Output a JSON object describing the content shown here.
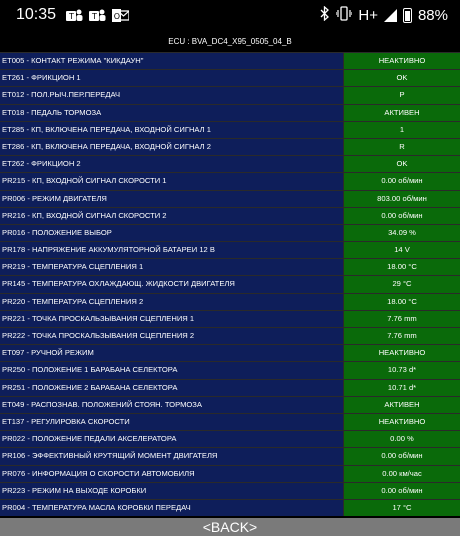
{
  "status_bar": {
    "time": "10:35",
    "notification_icons": [
      "teams-icon",
      "teams-icon",
      "outlook-icon"
    ],
    "battery": "88%",
    "network": "H+"
  },
  "ecu_label": "ECU : BVA_DC4_X95_0505_04_B",
  "rows": [
    {
      "name": "ET005 - КОНТАКТ РЕЖИМА \"КИКДАУН\"",
      "value": "НЕАКТИВНО"
    },
    {
      "name": "ET261 - ФРИКЦИОН 1",
      "value": "OK"
    },
    {
      "name": "ET012 - ПОЛ.РЫЧ.ПЕР.ПЕРЕДАЧ",
      "value": "P"
    },
    {
      "name": "ET018 - ПЕДАЛЬ ТОРМОЗА",
      "value": "АКТИВЕН"
    },
    {
      "name": "ET285 - КП, ВКЛЮЧЕНА ПЕРЕДАЧА, ВХОДНОЙ СИГНАЛ 1",
      "value": "1"
    },
    {
      "name": "ET286 - КП, ВКЛЮЧЕНА ПЕРЕДАЧА, ВХОДНОЙ СИГНАЛ 2",
      "value": "R"
    },
    {
      "name": "ET262 - ФРИКЦИОН 2",
      "value": "OK"
    },
    {
      "name": "PR215 - КП, ВХОДНОЙ СИГНАЛ СКОРОСТИ 1",
      "value": "0.00 об/мин"
    },
    {
      "name": "PR006 - РЕЖИМ ДВИГАТЕЛЯ",
      "value": "803.00 об/мин"
    },
    {
      "name": "PR216 - КП, ВХОДНОЙ СИГНАЛ СКОРОСТИ 2",
      "value": "0.00 об/мин"
    },
    {
      "name": "PR016 - ПОЛОЖЕНИЕ ВЫБОР",
      "value": "34.09 %"
    },
    {
      "name": "PR178 - НАПРЯЖЕНИЕ АККУМУЛЯТОРНОЙ БАТАРЕИ 12 В",
      "value": "14 V"
    },
    {
      "name": "PR219 - ТЕМПЕРАТУРА СЦЕПЛЕНИЯ 1",
      "value": "18.00 °C"
    },
    {
      "name": "PR145 - ТЕМПЕРАТУРА ОХЛАЖДАЮЩ. ЖИДКОСТИ ДВИГАТЕЛЯ",
      "value": "29 °C"
    },
    {
      "name": "PR220 - ТЕМПЕРАТУРА СЦЕПЛЕНИЯ 2",
      "value": "18.00 °C"
    },
    {
      "name": "PR221 - ТОЧКА ПРОСКАЛЬЗЫВАНИЯ СЦЕПЛЕНИЯ 1",
      "value": "7.76 mm"
    },
    {
      "name": "PR222 - ТОЧКА ПРОСКАЛЬЗЫВАНИЯ СЦЕПЛЕНИЯ 2",
      "value": "7.76 mm"
    },
    {
      "name": "ET097 - РУЧНОЙ РЕЖИМ",
      "value": "НЕАКТИВНО"
    },
    {
      "name": "PR250 - ПОЛОЖЕНИЕ 1 БАРАБАНА СЕЛЕКТОРА",
      "value": "10.73 d*"
    },
    {
      "name": "PR251 - ПОЛОЖЕНИЕ 2 БАРАБАНА СЕЛЕКТОРА",
      "value": "10.71 d*"
    },
    {
      "name": "ET049 - РАСПОЗНАВ. ПОЛОЖЕНИЙ СТОЯН. ТОРМОЗА",
      "value": "АКТИВЕН"
    },
    {
      "name": "ET137 - РЕГУЛИРОВКА СКОРОСТИ",
      "value": "НЕАКТИВНО"
    },
    {
      "name": "PR022 - ПОЛОЖЕНИЕ ПЕДАЛИ АКСЕЛЕРАТОРА",
      "value": "0.00 %"
    },
    {
      "name": "PR106 - ЭФФЕКТИВНЫЙ КРУТЯЩИЙ МОМЕНТ ДВИГАТЕЛЯ",
      "value": "0.00 об/мин"
    },
    {
      "name": "PR076 - ИНФОРМАЦИЯ О СКОРОСТИ АВТОМОБИЛЯ",
      "value": "0.00 км/час"
    },
    {
      "name": "PR223 - РЕЖИМ НА ВЫХОДЕ КОРОБКИ",
      "value": "0.00 об/мин"
    },
    {
      "name": "PR004 - ТЕМПЕРАТУРА МАСЛА КОРОБКИ ПЕРЕДАЧ",
      "value": "17 °C"
    }
  ],
  "back_label": "<BACK>",
  "colors": {
    "name_cell": "#0e1e5a",
    "value_cell": "#0a6a0a",
    "back_bar": "#7a7a7a"
  }
}
